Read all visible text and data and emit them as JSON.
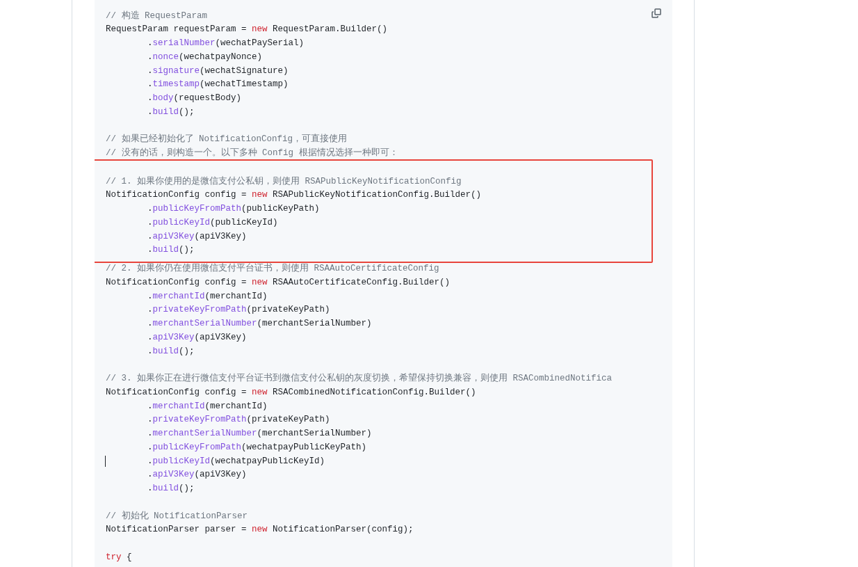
{
  "code_block": {
    "sections": [
      {
        "highlighted": false,
        "lines": [
          {
            "tokens": [
              {
                "kind": "comment",
                "text": "// 构造 RequestParam"
              }
            ]
          },
          {
            "tokens": [
              {
                "kind": "plain",
                "text": "RequestParam requestParam = "
              },
              {
                "kind": "keyword",
                "text": "new"
              },
              {
                "kind": "plain",
                "text": " RequestParam.Builder()"
              }
            ]
          },
          {
            "tokens": [
              {
                "kind": "plain",
                "text": "        ."
              },
              {
                "kind": "method",
                "text": "serialNumber"
              },
              {
                "kind": "plain",
                "text": "(wechatPaySerial)"
              }
            ]
          },
          {
            "tokens": [
              {
                "kind": "plain",
                "text": "        ."
              },
              {
                "kind": "method",
                "text": "nonce"
              },
              {
                "kind": "plain",
                "text": "(wechatpayNonce)"
              }
            ]
          },
          {
            "tokens": [
              {
                "kind": "plain",
                "text": "        ."
              },
              {
                "kind": "method",
                "text": "signature"
              },
              {
                "kind": "plain",
                "text": "(wechatSignature)"
              }
            ]
          },
          {
            "tokens": [
              {
                "kind": "plain",
                "text": "        ."
              },
              {
                "kind": "method",
                "text": "timestamp"
              },
              {
                "kind": "plain",
                "text": "(wechatTimestamp)"
              }
            ]
          },
          {
            "tokens": [
              {
                "kind": "plain",
                "text": "        ."
              },
              {
                "kind": "method",
                "text": "body"
              },
              {
                "kind": "plain",
                "text": "(requestBody)"
              }
            ]
          },
          {
            "tokens": [
              {
                "kind": "plain",
                "text": "        ."
              },
              {
                "kind": "method",
                "text": "build"
              },
              {
                "kind": "plain",
                "text": "();"
              }
            ]
          },
          {
            "blank": true
          },
          {
            "tokens": [
              {
                "kind": "comment",
                "text": "// 如果已经初始化了 NotificationConfig，可直接使用"
              }
            ]
          },
          {
            "tokens": [
              {
                "kind": "comment",
                "text": "// 没有的话，则构造一个。以下多种 Config 根据情况选择一种即可："
              }
            ]
          }
        ]
      },
      {
        "highlighted": true,
        "lines": [
          {
            "blank": true
          },
          {
            "tokens": [
              {
                "kind": "comment",
                "text": "// 1. 如果你使用的是微信支付公私钥，则使用 RSAPublicKeyNotificationConfig"
              }
            ]
          },
          {
            "tokens": [
              {
                "kind": "plain",
                "text": "NotificationConfig config = "
              },
              {
                "kind": "keyword",
                "text": "new"
              },
              {
                "kind": "plain",
                "text": " RSAPublicKeyNotificationConfig.Builder()"
              }
            ]
          },
          {
            "tokens": [
              {
                "kind": "plain",
                "text": "        ."
              },
              {
                "kind": "method",
                "text": "publicKeyFromPath"
              },
              {
                "kind": "plain",
                "text": "(publicKeyPath)"
              }
            ]
          },
          {
            "tokens": [
              {
                "kind": "plain",
                "text": "        ."
              },
              {
                "kind": "method",
                "text": "publicKeyId"
              },
              {
                "kind": "plain",
                "text": "(publicKeyId)"
              }
            ]
          },
          {
            "tokens": [
              {
                "kind": "plain",
                "text": "        ."
              },
              {
                "kind": "method",
                "text": "apiV3Key"
              },
              {
                "kind": "plain",
                "text": "(apiV3Key)"
              }
            ]
          },
          {
            "tokens": [
              {
                "kind": "plain",
                "text": "        ."
              },
              {
                "kind": "method",
                "text": "build"
              },
              {
                "kind": "plain",
                "text": "();"
              }
            ]
          }
        ]
      },
      {
        "highlighted": false,
        "lines": [
          {
            "tokens": [
              {
                "kind": "comment",
                "text": "// 2. 如果你仍在使用微信支付平台证书，则使用 RSAAutoCertificateConfig"
              }
            ]
          },
          {
            "tokens": [
              {
                "kind": "plain",
                "text": "NotificationConfig config = "
              },
              {
                "kind": "keyword",
                "text": "new"
              },
              {
                "kind": "plain",
                "text": " RSAAutoCertificateConfig.Builder()"
              }
            ]
          },
          {
            "tokens": [
              {
                "kind": "plain",
                "text": "        ."
              },
              {
                "kind": "method",
                "text": "merchantId"
              },
              {
                "kind": "plain",
                "text": "(merchantId)"
              }
            ]
          },
          {
            "tokens": [
              {
                "kind": "plain",
                "text": "        ."
              },
              {
                "kind": "method",
                "text": "privateKeyFromPath"
              },
              {
                "kind": "plain",
                "text": "(privateKeyPath)"
              }
            ]
          },
          {
            "tokens": [
              {
                "kind": "plain",
                "text": "        ."
              },
              {
                "kind": "method",
                "text": "merchantSerialNumber"
              },
              {
                "kind": "plain",
                "text": "(merchantSerialNumber)"
              }
            ]
          },
          {
            "tokens": [
              {
                "kind": "plain",
                "text": "        ."
              },
              {
                "kind": "method",
                "text": "apiV3Key"
              },
              {
                "kind": "plain",
                "text": "(apiV3Key)"
              }
            ]
          },
          {
            "tokens": [
              {
                "kind": "plain",
                "text": "        ."
              },
              {
                "kind": "method",
                "text": "build"
              },
              {
                "kind": "plain",
                "text": "();"
              }
            ]
          },
          {
            "blank": true
          },
          {
            "tokens": [
              {
                "kind": "comment",
                "text": "// 3. 如果你正在进行微信支付平台证书到微信支付公私钥的灰度切换，希望保持切换兼容，则使用 RSACombinedNotifica"
              }
            ]
          },
          {
            "tokens": [
              {
                "kind": "plain",
                "text": "NotificationConfig config = "
              },
              {
                "kind": "keyword",
                "text": "new"
              },
              {
                "kind": "plain",
                "text": " RSACombinedNotificationConfig.Builder()"
              }
            ]
          },
          {
            "tokens": [
              {
                "kind": "plain",
                "text": "        ."
              },
              {
                "kind": "method",
                "text": "merchantId"
              },
              {
                "kind": "plain",
                "text": "(merchantId)"
              }
            ]
          },
          {
            "tokens": [
              {
                "kind": "plain",
                "text": "        ."
              },
              {
                "kind": "method",
                "text": "privateKeyFromPath"
              },
              {
                "kind": "plain",
                "text": "(privateKeyPath)"
              }
            ]
          },
          {
            "tokens": [
              {
                "kind": "plain",
                "text": "        ."
              },
              {
                "kind": "method",
                "text": "merchantSerialNumber"
              },
              {
                "kind": "plain",
                "text": "(merchantSerialNumber)"
              }
            ]
          },
          {
            "tokens": [
              {
                "kind": "plain",
                "text": "        ."
              },
              {
                "kind": "method",
                "text": "publicKeyFromPath"
              },
              {
                "kind": "plain",
                "text": "(wechatpayPublicKeyPath)"
              }
            ]
          },
          {
            "cursor": true,
            "tokens": [
              {
                "kind": "plain",
                "text": "        ."
              },
              {
                "kind": "method",
                "text": "publicKeyId"
              },
              {
                "kind": "plain",
                "text": "(wechatpayPublicKeyId)"
              }
            ]
          },
          {
            "tokens": [
              {
                "kind": "plain",
                "text": "        ."
              },
              {
                "kind": "method",
                "text": "apiV3Key"
              },
              {
                "kind": "plain",
                "text": "(apiV3Key)"
              }
            ]
          },
          {
            "tokens": [
              {
                "kind": "plain",
                "text": "        ."
              },
              {
                "kind": "method",
                "text": "build"
              },
              {
                "kind": "plain",
                "text": "();"
              }
            ]
          },
          {
            "blank": true
          },
          {
            "tokens": [
              {
                "kind": "comment",
                "text": "// 初始化 NotificationParser"
              }
            ]
          },
          {
            "tokens": [
              {
                "kind": "plain",
                "text": "NotificationParser parser = "
              },
              {
                "kind": "keyword",
                "text": "new"
              },
              {
                "kind": "plain",
                "text": " NotificationParser(config);"
              }
            ]
          },
          {
            "blank": true
          },
          {
            "tokens": [
              {
                "kind": "keyword",
                "text": "try"
              },
              {
                "kind": "plain",
                "text": " {"
              }
            ]
          }
        ]
      }
    ]
  }
}
